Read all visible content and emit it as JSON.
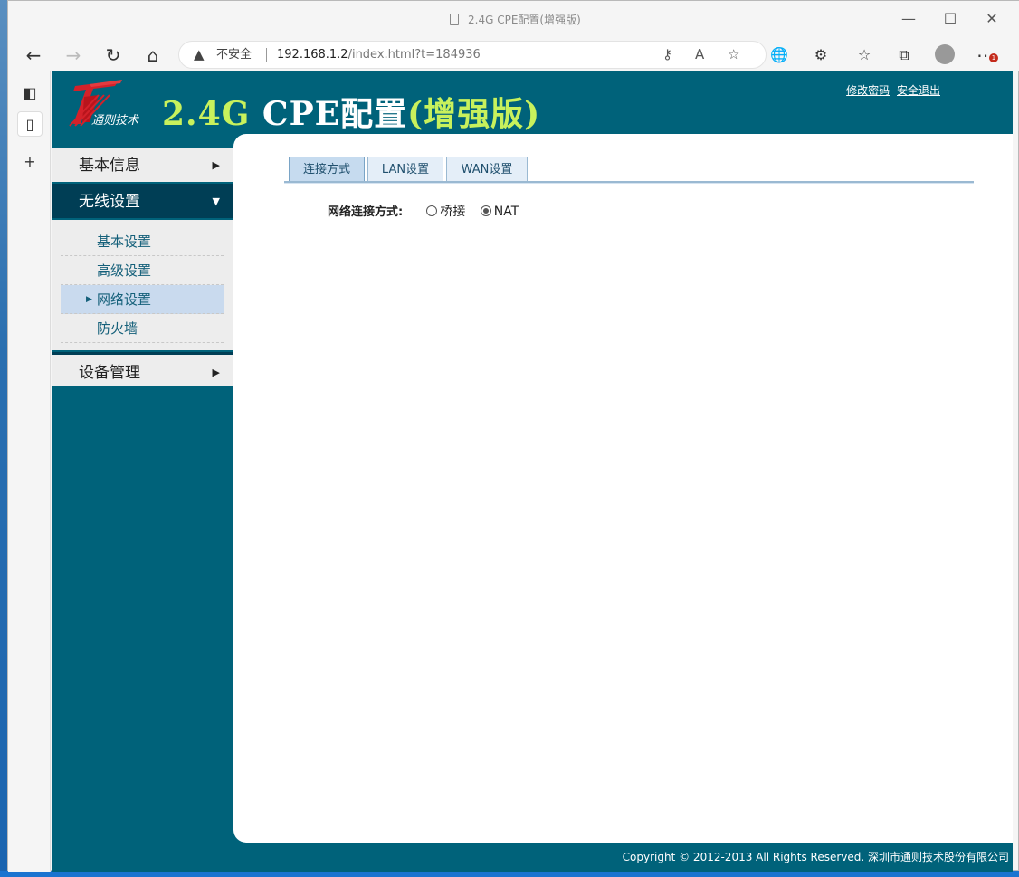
{
  "window": {
    "title": "2.4G CPE配置(增强版)",
    "controls": {
      "minimize": "—",
      "maximize": "☐",
      "close": "✕"
    }
  },
  "toolbar": {
    "security_warning": "不安全",
    "url_host": "192.168.1.2",
    "url_path": "/index.html?t=184936",
    "icons": [
      "back-icon",
      "forward-icon",
      "refresh-icon",
      "home-icon",
      "key-icon",
      "read-aloud-icon",
      "favorite-add-icon",
      "extension-globe-icon",
      "extensions-icon",
      "favorites-icon",
      "collections-icon",
      "profile-icon",
      "more-icon"
    ],
    "notification_count": "1"
  },
  "header": {
    "brand_sub": "通则技术",
    "title_part1": "2.4G ",
    "title_part2": "CPE配置",
    "title_part3": "(增强版)",
    "link_change_password": "修改密码",
    "link_logout": "安全退出"
  },
  "menu": {
    "basic_info": "基本信息",
    "wireless": "无线设置",
    "wireless_items": [
      "基本设置",
      "高级设置",
      "网络设置",
      "防火墙"
    ],
    "device_mgmt": "设备管理"
  },
  "content": {
    "tabs": [
      "连接方式",
      "LAN设置",
      "WAN设置"
    ],
    "active_tab": "连接方式",
    "field_label": "网络连接方式:",
    "options": [
      "桥接",
      "NAT"
    ],
    "selected_option": "NAT"
  },
  "footer": {
    "copyright": "Copyright © 2012-2013 All Rights Reserved. 深圳市通则技术股份有限公司"
  },
  "colors": {
    "page_bg": "#00627a",
    "menu_active": "#003e55",
    "title_accent": "#c8f15c",
    "logo_red": "#d4212a"
  }
}
